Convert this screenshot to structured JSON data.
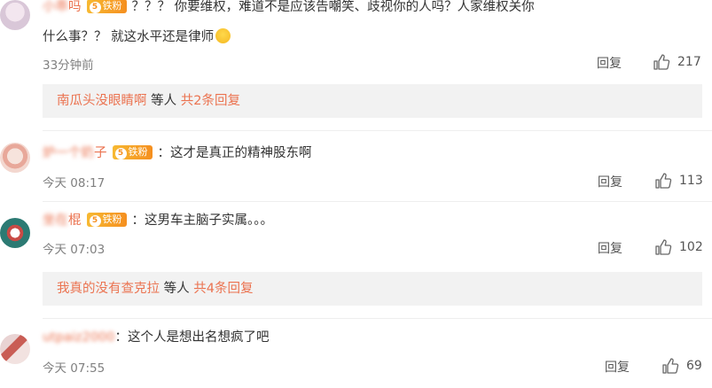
{
  "comments": [
    {
      "username": "小乖",
      "username_suffix": "吗",
      "badge": "铁粉",
      "badge_level": "5",
      "text_line1": "？？？ 你要维权，难道不是应该告嘲笑、歧视你的人吗？人家维权关你",
      "text_line2": "什么事？？ 就这水平还是律师",
      "emoji": "smile-emoji",
      "time": "33分钟前",
      "reply": "回复",
      "likes": "217",
      "sub": {
        "name": "南瓜头没眼睛啊",
        "middle": " 等人 ",
        "count": "共2条回复"
      }
    },
    {
      "username": "炉一个奶",
      "username_suffix": "子",
      "badge": "铁粉",
      "badge_level": "5",
      "text_line1": "：这才是真正的精神股东啊",
      "time": "今天 08:17",
      "reply": "回复",
      "likes": "113"
    },
    {
      "username": "坐在",
      "username_suffix": "棍",
      "badge": "铁粉",
      "badge_level": "5",
      "text_line1": "：这男车主脑子实属。。。",
      "time": "今天 07:03",
      "reply": "回复",
      "likes": "102",
      "sub": {
        "name": "我真的没有查克拉",
        "middle": " 等人 ",
        "count": "共4条回复"
      }
    },
    {
      "username": "utpaiz2000",
      "text_line1": "：这个人是想出名想疯了吧",
      "time": "今天 07:55",
      "reply": "回复",
      "likes": "69"
    }
  ],
  "colors": {
    "accent": "#eb7350",
    "meta": "#808080",
    "subbg": "#f2f2f2"
  },
  "icons": {
    "like": "thumbs-up-icon"
  }
}
